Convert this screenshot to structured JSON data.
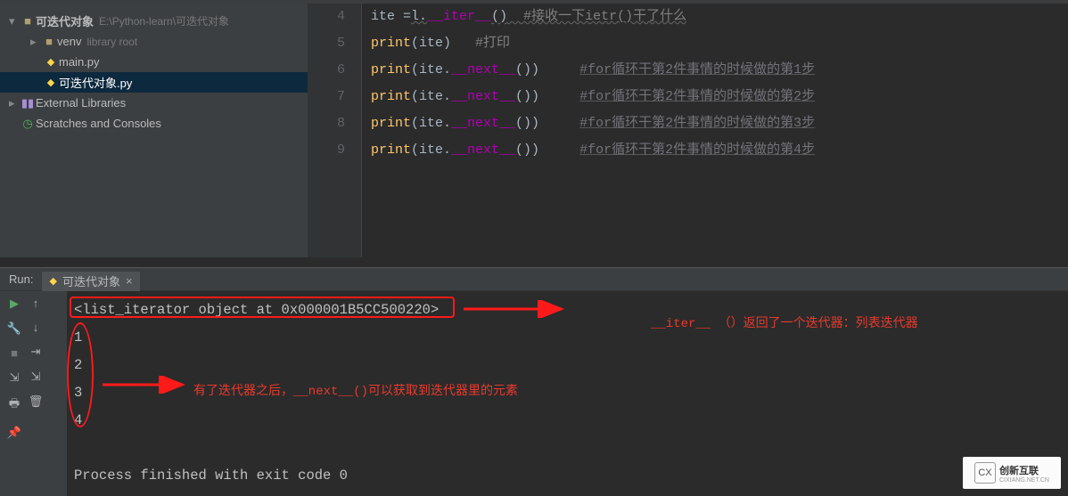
{
  "sidebar": {
    "project": {
      "name": "可迭代对象",
      "path": "E:\\Python-learn\\可迭代对象"
    },
    "venv": {
      "name": "venv",
      "note": "library root"
    },
    "main": "main.py",
    "active": "可迭代对象.py",
    "external": "External Libraries",
    "scratches": "Scratches and Consoles"
  },
  "editor": {
    "lines": [
      "4",
      "5",
      "6",
      "7",
      "8",
      "9"
    ],
    "code": {
      "l4_a": "ite ",
      "l4_eq": "=",
      "l4_b": "l.",
      "l4_c": "__iter__",
      "l4_d": "()",
      "l4_e": "  #接收一下ietr()干了什么",
      "l5_a": "print",
      "l5_b": "(ite)",
      "l5_c": "   #打印",
      "l6_a": "print",
      "l6_b": "(ite.",
      "l6_c": "__next__",
      "l6_d": "())",
      "l6_e": "     ",
      "l6_f": "#for循环干第2件事情的时候做的第1步",
      "l7_a": "print",
      "l7_b": "(ite.",
      "l7_c": "__next__",
      "l7_d": "())",
      "l7_f": "#for循环干第2件事情的时候做的第2步",
      "l8_a": "print",
      "l8_b": "(ite.",
      "l8_c": "__next__",
      "l8_d": "())",
      "l8_f": "#for循环干第2件事情的时候做的第3步",
      "l9_a": "print",
      "l9_b": "(ite.",
      "l9_c": "__next__",
      "l9_d": "())",
      "l9_f": "#for循环干第2件事情的时候做的第4步"
    }
  },
  "run": {
    "label": "Run:",
    "tab": "可迭代对象",
    "output": {
      "obj": "<list_iterator object at 0x000001B5CC500220>",
      "v1": "1",
      "v2": "2",
      "v3": "3",
      "v4": "4",
      "exit": "Process finished with exit code 0"
    },
    "annot1": "__iter__ （）返回了一个迭代器：列表迭代器",
    "annot2": "有了迭代器之后，__next__()可以获取到迭代器里的元素"
  },
  "watermark": {
    "text": "创新互联",
    "sub": "CIXIANG.NET.CN",
    "logo": "CX"
  }
}
